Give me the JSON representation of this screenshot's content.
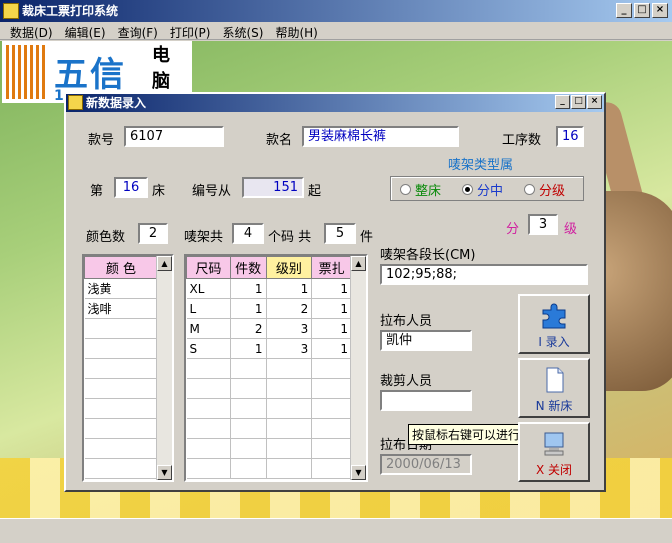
{
  "window": {
    "title": "裁床工票打印系统"
  },
  "menu": [
    "数据(D)",
    "编辑(E)",
    "查询(F)",
    "打印(P)",
    "系统(S)",
    "帮助(H)"
  ],
  "logo": {
    "text": "五信",
    "sub1": "电",
    "sub2": "脑",
    "num": "1"
  },
  "dialog": {
    "title": "新数据录入",
    "style_no_label": "款号",
    "style_no": "6107",
    "style_name_label": "款名",
    "style_name": "男装麻棉长裤",
    "process_count_label": "工序数",
    "process_count": "16",
    "bed_prefix": "第",
    "bed_no": "16",
    "bed_suffix": "床",
    "number_from_label": "编号从",
    "number_from": "151",
    "number_from_suffix": "起",
    "rack_type_title": "唛架类型属",
    "rack_options": [
      "整床",
      "分中",
      "分级"
    ],
    "rack_selected": "分中",
    "colors_count_label": "颜色数",
    "colors_count": "2",
    "rack_total_label": "唛架共",
    "rack_total": "4",
    "sizes_label": "个码 共",
    "pieces": "5",
    "pieces_suffix": "件",
    "grade_prefix": "分",
    "grade": "3",
    "grade_suffix": "级",
    "segment_length_label": "唛架各段长(CM)",
    "segment_length": "102;95;88;",
    "spreader_label": "拉布人员",
    "spreader": "凯仲",
    "cutter_label": "裁剪人员",
    "cutter": "",
    "spread_date_label": "拉布日期",
    "spread_date": "2000/06/13",
    "tooltip": "按鼠标右键可以进行选择",
    "color_table": {
      "header": "颜 色",
      "rows": [
        "浅黄",
        "浅啡"
      ]
    },
    "size_table": {
      "headers": [
        "尺码",
        "件数",
        "级别",
        "票扎"
      ],
      "rows": [
        [
          "XL",
          "1",
          "1",
          "1"
        ],
        [
          "L",
          "1",
          "2",
          "1"
        ],
        [
          "M",
          "2",
          "3",
          "1"
        ],
        [
          "S",
          "1",
          "3",
          "1"
        ]
      ]
    },
    "buttons": {
      "enter": "I 录入",
      "new": "N 新床",
      "close": "X 关闭"
    }
  }
}
